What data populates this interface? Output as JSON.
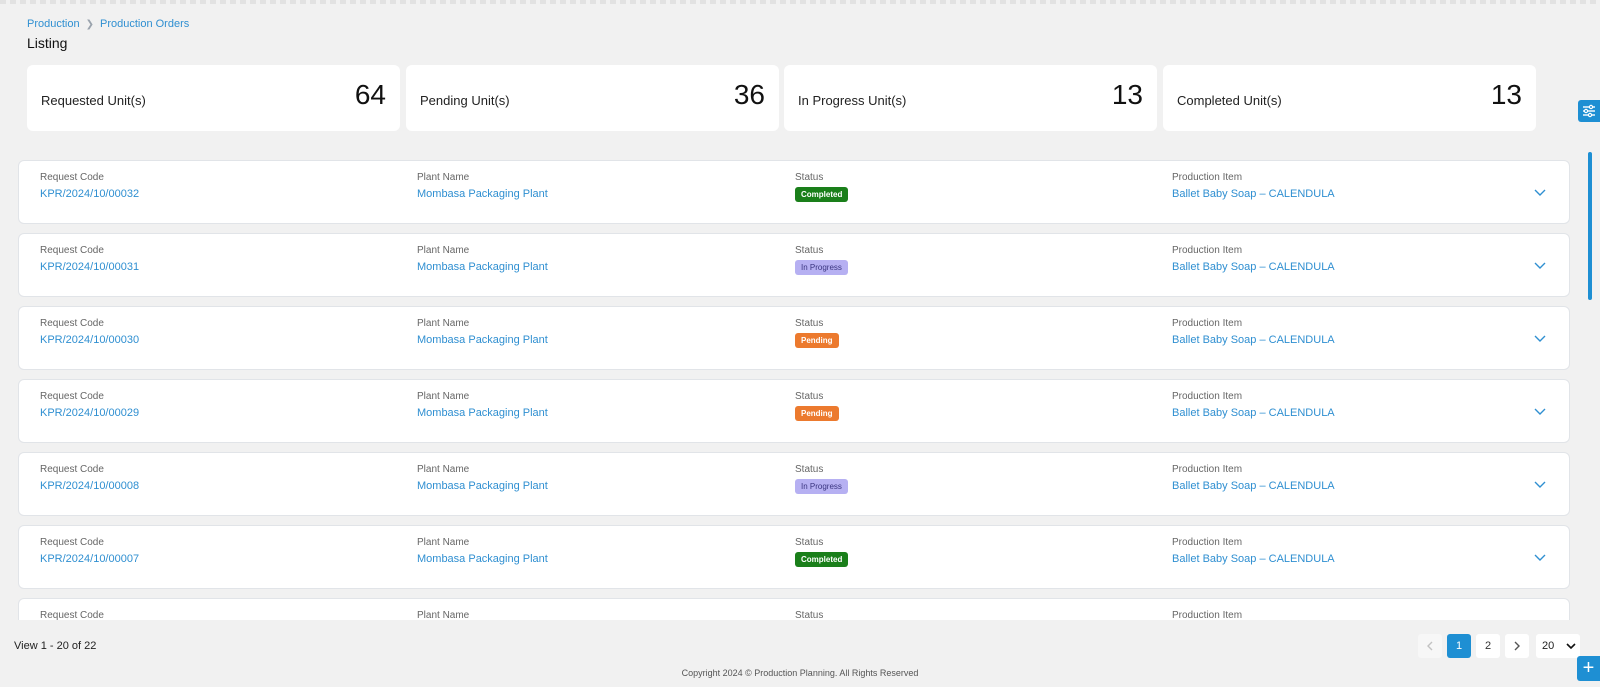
{
  "breadcrumb": {
    "root": "Production",
    "current": "Production Orders"
  },
  "page_title": "Listing",
  "stats": [
    {
      "label": "Requested Unit(s)",
      "value": "64"
    },
    {
      "label": "Pending Unit(s)",
      "value": "36"
    },
    {
      "label": "In Progress Unit(s)",
      "value": "13"
    },
    {
      "label": "Completed Unit(s)",
      "value": "13"
    }
  ],
  "columns": {
    "code": "Request Code",
    "plant": "Plant Name",
    "status": "Status",
    "item": "Production Item"
  },
  "rows": [
    {
      "code": "KPR/2024/10/00032",
      "plant": "Mombasa Packaging Plant",
      "status": "Completed",
      "item": "Ballet Baby Soap – CALENDULA"
    },
    {
      "code": "KPR/2024/10/00031",
      "plant": "Mombasa Packaging Plant",
      "status": "In Progress",
      "item": "Ballet Baby Soap – CALENDULA"
    },
    {
      "code": "KPR/2024/10/00030",
      "plant": "Mombasa Packaging Plant",
      "status": "Pending",
      "item": "Ballet Baby Soap – CALENDULA"
    },
    {
      "code": "KPR/2024/10/00029",
      "plant": "Mombasa Packaging Plant",
      "status": "Pending",
      "item": "Ballet Baby Soap – CALENDULA"
    },
    {
      "code": "KPR/2024/10/00008",
      "plant": "Mombasa Packaging Plant",
      "status": "In Progress",
      "item": "Ballet Baby Soap – CALENDULA"
    },
    {
      "code": "KPR/2024/10/00007",
      "plant": "Mombasa Packaging Plant",
      "status": "Completed",
      "item": "Ballet Baby Soap – CALENDULA"
    }
  ],
  "pagination": {
    "view_text": "View 1 - 20 of 22",
    "pages": [
      "1",
      "2"
    ],
    "active_page": "1",
    "page_size": "20"
  },
  "footer": "Copyright 2024 © Production Planning. All Rights Reserved",
  "colors": {
    "accent": "#1e8fd3",
    "link": "#2f8fd1",
    "completed": "#1a7f1a",
    "in_progress": "#b6b0f2",
    "pending": "#ec7a2e"
  },
  "icons": {
    "filter": "sliders-icon",
    "expand": "chevron-down-icon",
    "prev": "chevron-left-icon",
    "next": "chevron-right-icon",
    "add": "plus-icon"
  }
}
